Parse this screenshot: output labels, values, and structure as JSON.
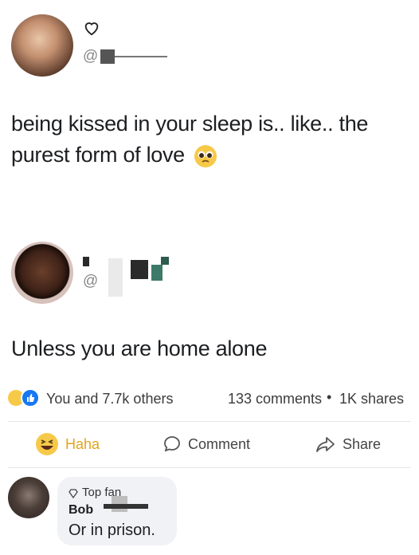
{
  "tweet1": {
    "handle_prefix": "@",
    "text": "being kissed in your sleep is.. like.. the purest form of love",
    "icon": "pleading-face-emoji"
  },
  "tweet2": {
    "handle_prefix": "@",
    "text": "Unless you are home alone"
  },
  "post": {
    "reactions_text": "You and 7.7k others",
    "comments_text": "133 comments",
    "shares_text": "1K shares"
  },
  "actions": {
    "haha_label": "Haha",
    "comment_label": "Comment",
    "share_label": "Share"
  },
  "comment": {
    "badge": "Top fan",
    "author_fragment": "Bob",
    "text": "Or in prison."
  },
  "colors": {
    "haha": "#f0a823",
    "like_blue": "#1877f2",
    "text": "#1c1e21",
    "bubble": "#f0f2f5"
  }
}
